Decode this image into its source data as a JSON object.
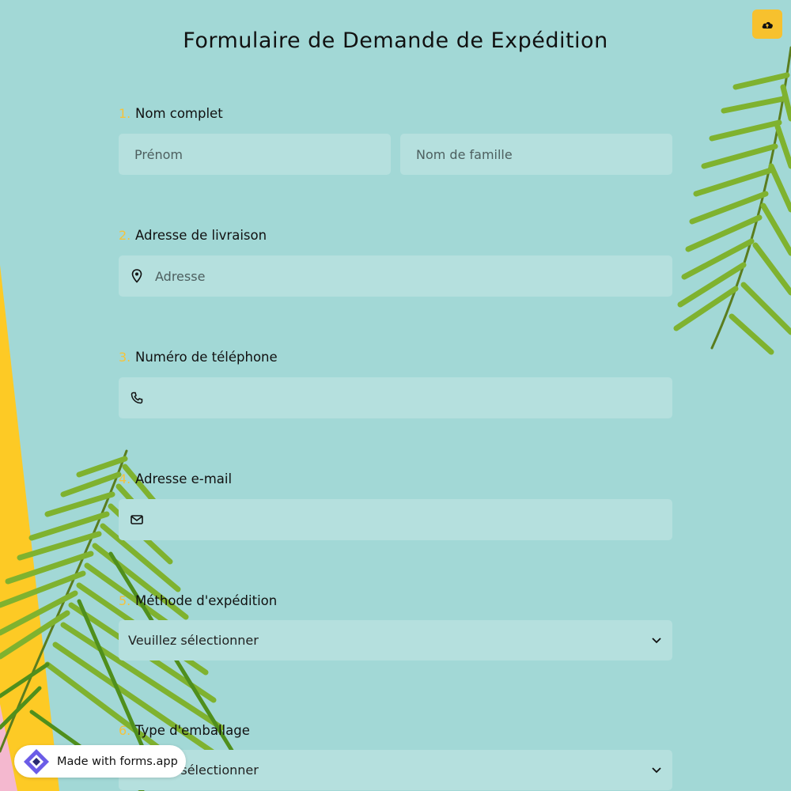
{
  "page": {
    "title": "Formulaire de Demande de Expédition",
    "upload_icon": "cloud-upload-icon",
    "accent_color": "#f7c12e",
    "background_color": "#a2d8d6",
    "field_color": "#b5e0de"
  },
  "questions": [
    {
      "number": "1.",
      "label": "Nom complet",
      "fields": [
        {
          "placeholder": "Prénom"
        },
        {
          "placeholder": "Nom de famille"
        }
      ]
    },
    {
      "number": "2.",
      "label": "Adresse de livraison",
      "icon": "map-pin-icon",
      "placeholder": "Adresse"
    },
    {
      "number": "3.",
      "label": "Numéro de téléphone",
      "icon": "phone-icon",
      "placeholder": ""
    },
    {
      "number": "4.",
      "label": "Adresse e-mail",
      "icon": "envelope-icon",
      "placeholder": ""
    },
    {
      "number": "5.",
      "label": "Méthode d'expédition",
      "selected": "Veuillez sélectionner",
      "icon": "chevron-down-icon"
    },
    {
      "number": "6.",
      "label": "Type d'emballage",
      "selected": "Veuillez sélectionner",
      "icon": "chevron-down-icon"
    }
  ],
  "badge": {
    "text": "Made with forms.app",
    "icon": "forms-app-logo-icon"
  }
}
